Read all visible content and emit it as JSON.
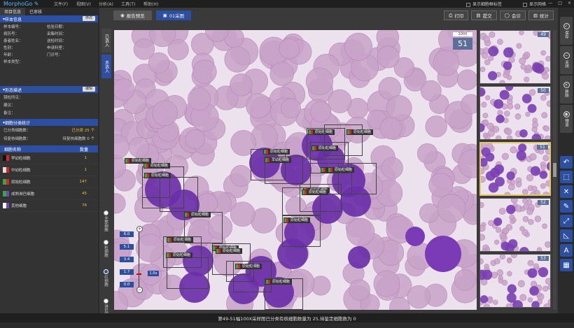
{
  "app": {
    "brand": "MorphoGo",
    "menu": [
      "文件(F)",
      "视图(V)",
      "分析(A)",
      "工具(T)",
      "帮助(H)"
    ],
    "options": [
      "显示细胞框标签",
      "显示网格"
    ],
    "window_controls": [
      "—",
      "□",
      "×"
    ]
  },
  "left": {
    "tabs": [
      "项目信息",
      "已审核"
    ],
    "sample_header": "样本信息",
    "sample_button": "修改",
    "sample_fields": [
      "样本编号：",
      "病历号：",
      "患者姓名：",
      "性别：",
      "年龄：",
      "科室：",
      "床号：",
      "送检医生：",
      "临床诊断：",
      "样本类型："
    ],
    "sample_fields_right": [
      "检验日期：",
      "采集时间：",
      "送检时间：",
      "申请科室：",
      "门诊号："
    ],
    "result_header": "形态描述",
    "result_button": "编辑",
    "result_fields": [
      "镜检所见：",
      "建议：",
      "备注："
    ],
    "classify_header": "细胞分类统计",
    "classify_rows": [
      {
        "label": "已分类细胞数：",
        "value": "已分类 25 个"
      },
      {
        "label": "待复核细胞数：",
        "value": "待复核细胞数 0 个"
      }
    ],
    "table_headers": [
      "细胞名称",
      "数量"
    ],
    "table_rows": [
      {
        "name": "早幼粒细胞",
        "count": "1",
        "c1": "#111111",
        "c2": "#dd2222"
      },
      {
        "name": "中幼粒细胞",
        "count": "1",
        "c1": "#dddddd",
        "c2": "#dd2222"
      },
      {
        "name": "原始粒细胞",
        "count": "147",
        "c1": "#33a840",
        "c2": "#dd2222"
      },
      {
        "name": "成熟淋巴细胞",
        "count": "45",
        "c1": "#33a840",
        "c2": "#7a3fbf"
      },
      {
        "name": "其他细胞",
        "count": "76",
        "c1": "#ffffff",
        "c2": "#7a3fbf"
      }
    ]
  },
  "center": {
    "tabs": [
      "报告预览",
      "01采图"
    ],
    "tools": [
      "打印",
      "提交",
      "会诊",
      "统计"
    ],
    "vtabs": [
      "已选入",
      "未选入"
    ],
    "radios": [
      "全部细胞",
      "粒细胞",
      "红细胞",
      "淋巴细胞",
      "单核细胞"
    ],
    "objective": "100X",
    "field_number": "51",
    "zoom_levels": [
      "6.0",
      "5.1",
      "3.4",
      "1.7",
      "0.0"
    ],
    "zoom_value": "1.0x",
    "cell_labels": [
      "原始粒细胞",
      "原始粒细胞",
      "原始粒细胞",
      "早幼粒细胞",
      "原始粒细胞",
      "原始粒细胞",
      "原始粒细胞",
      "原始粒细胞",
      "原始粒细胞",
      "原始粒细胞",
      "原始粒细胞",
      "原始粒细胞",
      "原始粒细胞",
      "原始粒细胞",
      "原始粒细胞",
      "原始粒细胞",
      "原始粒细胞",
      "原始粒细胞",
      "原始粒细胞",
      "原始粒细胞"
    ]
  },
  "thumbs": [
    {
      "num": "49"
    },
    {
      "num": "50"
    },
    {
      "num": "51"
    },
    {
      "num": "52"
    },
    {
      "num": "53"
    }
  ],
  "right": {
    "buttons": [
      "保存",
      "关闭",
      "移除",
      "预览"
    ],
    "tools": [
      "↶",
      "⬚",
      "✕",
      "✎",
      "⤢",
      "◺",
      "A",
      "▦"
    ]
  },
  "status": "第49-51幅100X采样图已分类有核细胞数量为 25,待鉴定细胞数为 0"
}
